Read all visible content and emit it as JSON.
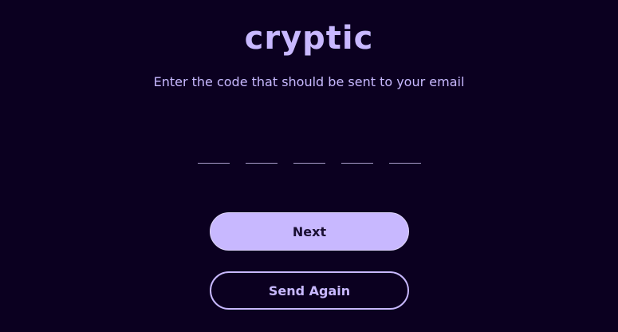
{
  "brand": {
    "name": "cryptic"
  },
  "verify": {
    "prompt": "Enter the code that should be sent to your email",
    "code_fields": [
      "",
      "",
      "",
      "",
      ""
    ]
  },
  "actions": {
    "next_label": "Next",
    "send_again_label": "Send Again"
  },
  "colors": {
    "background": "#0b0020",
    "accent": "#c8b8ff",
    "button_text_dark": "#1a1033"
  }
}
